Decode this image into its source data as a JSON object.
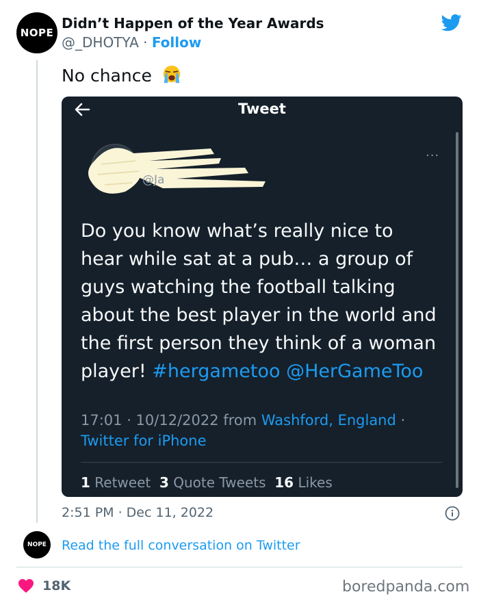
{
  "author": {
    "avatar_text": "NOPE",
    "name": "Didn’t Happen of the Year Awards",
    "handle": "@_DHOTYA",
    "separator": "·",
    "follow_label": "Follow"
  },
  "tweet": {
    "text": "No chance",
    "emoji": "loudly-crying-face-emoji"
  },
  "embedded": {
    "header_title": "Tweet",
    "more_label": "···",
    "partial_handle": "@Ja",
    "text_lines": [
      "Do you know what’s really nice to",
      "hear while sat at a pub… a group of",
      "guys watching the football talking",
      "about the best player in the world and",
      "the first person they think of a woman",
      "player!"
    ],
    "hashtag": "#hergametoo",
    "mention": "@HerGameToo",
    "time": "17:01 · 10/12/2022",
    "from": "from",
    "location": "Washford, England",
    "dot": "·",
    "source": "Twitter for iPhone",
    "retweets_count": "1",
    "retweets_label": "Retweet",
    "quotes_count": "3",
    "quotes_label": "Quote Tweets",
    "likes_count": "16",
    "likes_label": "Likes"
  },
  "timestamp": "2:51 PM · Dec 11, 2022",
  "conversation": {
    "avatar_text": "NOPE",
    "link_label": "Read the full conversation on Twitter"
  },
  "footer": {
    "likes": "18K",
    "watermark": "boredpanda.com"
  },
  "colors": {
    "twitter_blue": "#1d9bf0",
    "card_bg": "#15202b",
    "heart": "#f91880"
  }
}
